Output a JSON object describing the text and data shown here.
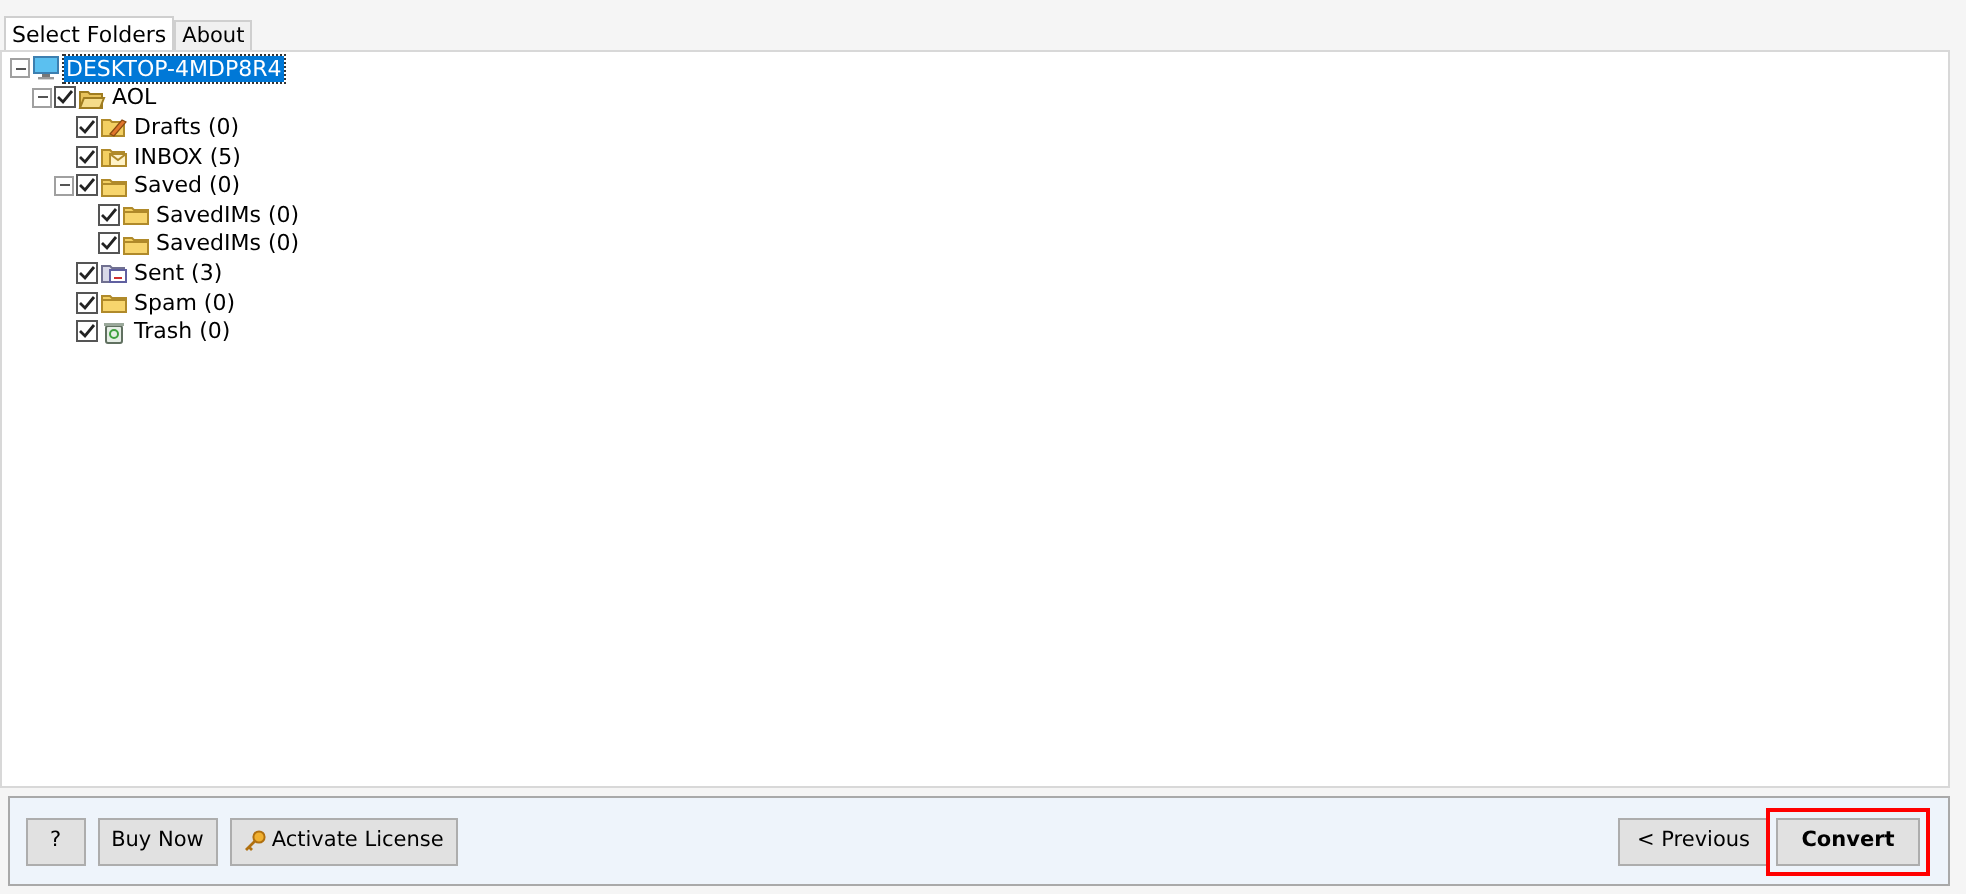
{
  "tabs": [
    {
      "label": "Select Folders",
      "selected": true
    },
    {
      "label": "About",
      "selected": false
    }
  ],
  "tree": [
    {
      "label": "DESKTOP-4MDP8R4",
      "kind": "computer",
      "expanded": true,
      "selected": true,
      "children": [
        {
          "label": "AOL",
          "kind": "account",
          "expanded": true,
          "checked": true,
          "selected": false,
          "children": [
            {
              "label": "Drafts (0)",
              "kind": "drafts",
              "checked": true,
              "selected": false
            },
            {
              "label": "INBOX (5)",
              "kind": "inbox",
              "checked": true,
              "selected": false
            },
            {
              "label": "Saved (0)",
              "kind": "folder",
              "expanded": true,
              "checked": true,
              "selected": false,
              "children": [
                {
                  "label": "SavedIMs (0)",
                  "kind": "folder",
                  "checked": true,
                  "selected": false
                },
                {
                  "label": "SavedIMs (0)",
                  "kind": "folder",
                  "checked": true,
                  "selected": false
                }
              ]
            },
            {
              "label": "Sent (3)",
              "kind": "sent",
              "checked": true,
              "selected": false
            },
            {
              "label": "Spam (0)",
              "kind": "folder",
              "checked": true,
              "selected": false
            },
            {
              "label": "Trash (0)",
              "kind": "trash",
              "checked": true,
              "selected": false
            }
          ]
        }
      ]
    }
  ],
  "buttons_left": [
    {
      "label": "?",
      "kind": "help"
    },
    {
      "label": "Buy Now",
      "kind": "plain"
    },
    {
      "label": "Activate License",
      "kind": "key"
    }
  ],
  "buttons_right": [
    {
      "label": "< Previous",
      "highlighted": false
    },
    {
      "label": "Convert",
      "highlighted": true
    }
  ]
}
